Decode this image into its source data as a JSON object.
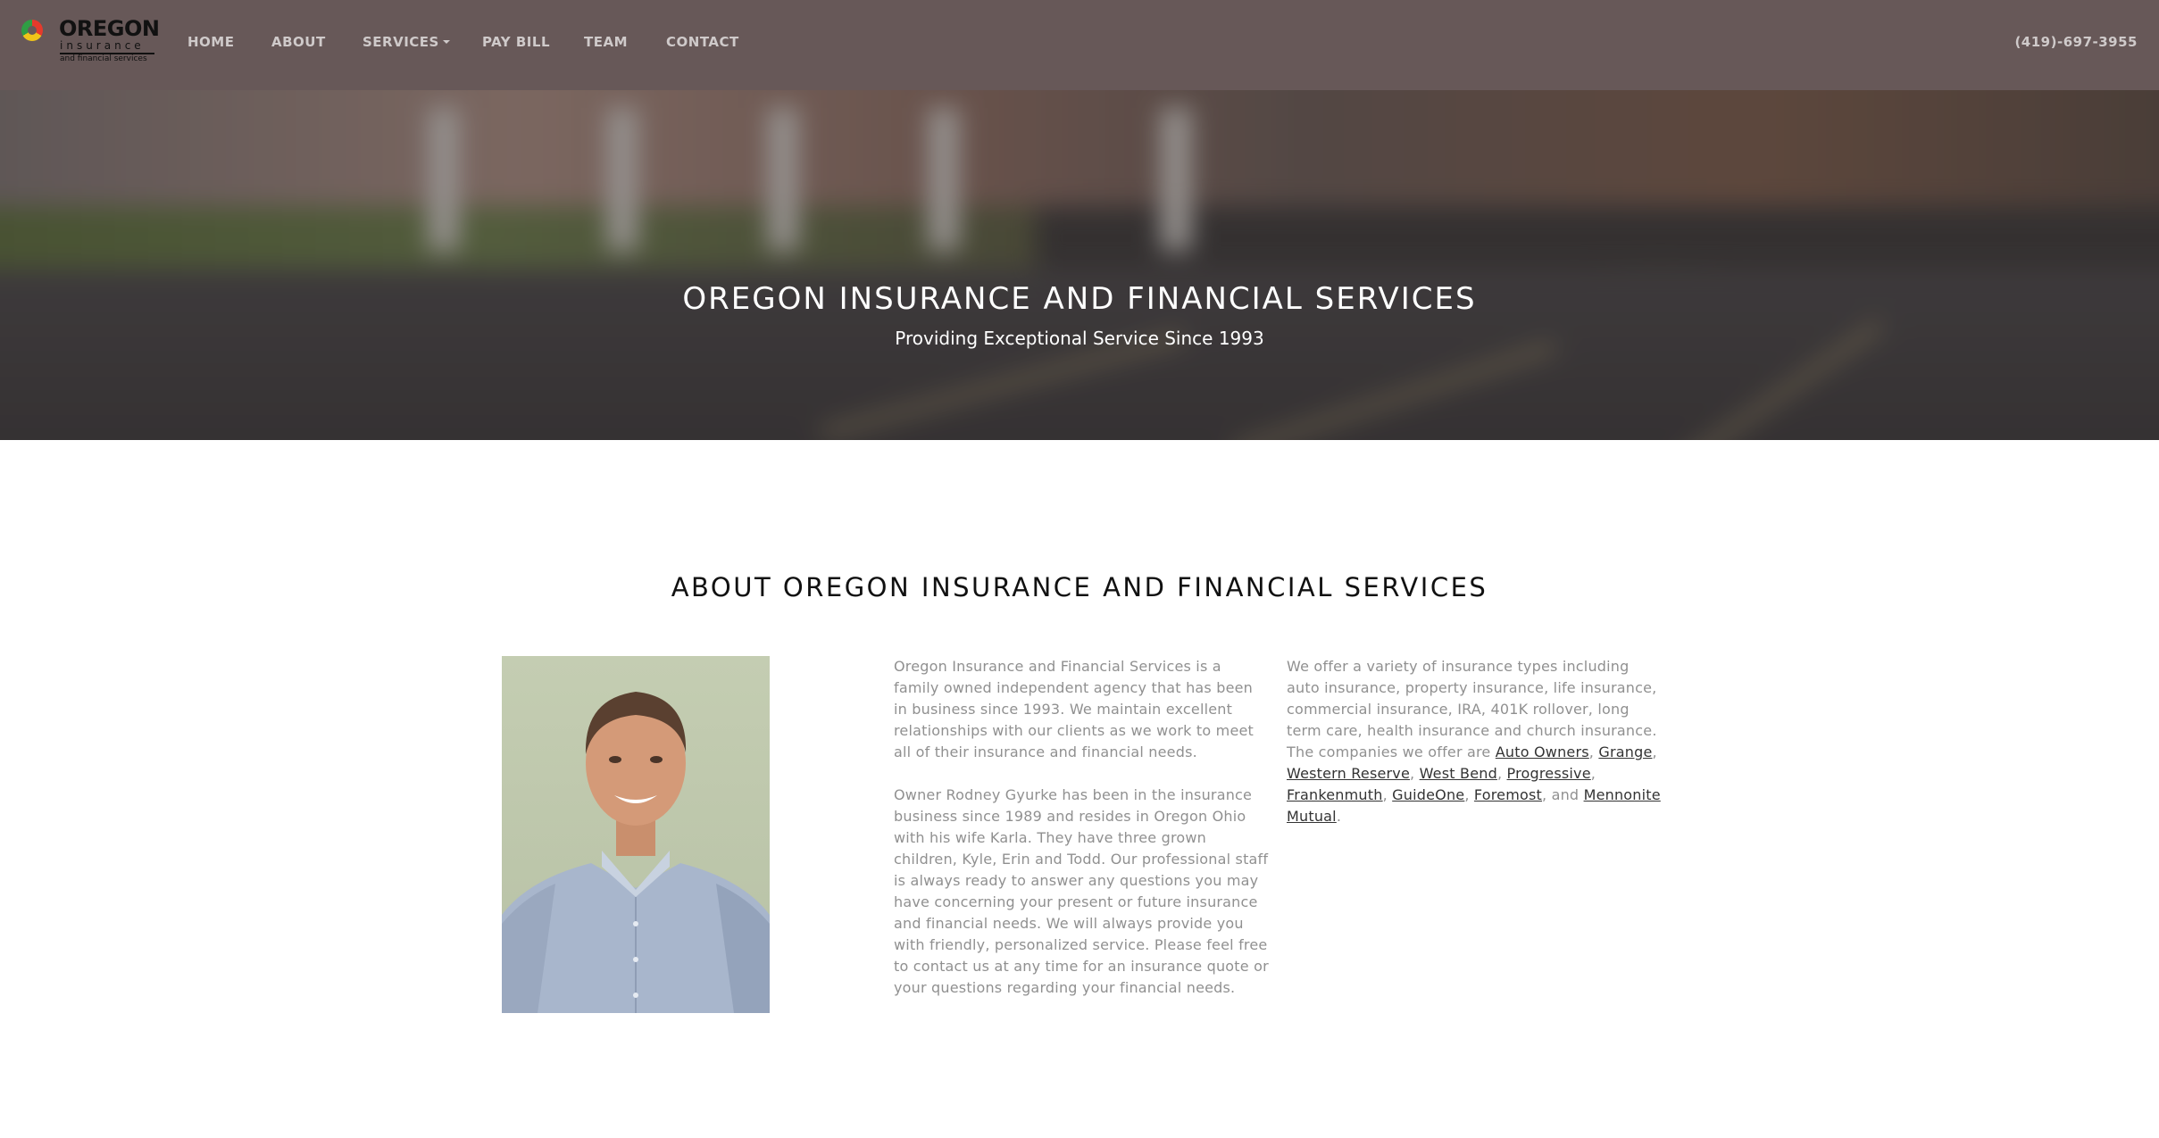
{
  "brand": {
    "logo_name": "OREGON",
    "logo_line2": "insurance",
    "logo_line3": "and financial services"
  },
  "nav": {
    "items": [
      {
        "label": "HOME"
      },
      {
        "label": "ABOUT"
      },
      {
        "label": "SERVICES"
      },
      {
        "label": "PAY BILL"
      },
      {
        "label": "TEAM"
      },
      {
        "label": "CONTACT"
      }
    ],
    "phone": "(419)-697-3955"
  },
  "hero": {
    "title": "OREGON INSURANCE AND FINANCIAL SERVICES",
    "subtitle": "Providing Exceptional Service Since 1993"
  },
  "about": {
    "heading": "ABOUT OREGON INSURANCE AND FINANCIAL SERVICES",
    "col1_p1": "Oregon Insurance and Financial Services is a family owned independent agency that has been in business since 1993. We maintain excellent relationships with our clients as we work to meet all of their insurance and financial needs.",
    "col1_p2": "Owner Rodney Gyurke has been in the insurance business since 1989 and resides in Oregon Ohio with his wife Karla. They have three grown children, Kyle, Erin and Todd. Our professional staff is always ready to answer any questions you may have concerning your present or future insurance and financial needs. We will always provide you with friendly, personalized service. Please feel free to contact us at any time for an insurance quote or your questions regarding your financial needs.",
    "col2_intro": "We offer a variety of insurance types including auto insurance, property insurance, life insurance, commercial insurance, IRA, 401K rollover, long term care, health insurance and church insurance. The companies we offer are ",
    "companies": [
      "Auto Owners",
      "Grange",
      "Western Reserve",
      "West Bend",
      "Progressive",
      "Frankenmuth",
      "GuideOne",
      "Foremost",
      "Mennonite Mutual"
    ],
    "sep_comma": ", ",
    "sep_and": ", and ",
    "end_period": "."
  },
  "colors": {
    "navbar": "#675858",
    "nav_text": "#cfcaca",
    "heading": "#111111",
    "body_text": "#909090",
    "link": "#333333"
  }
}
